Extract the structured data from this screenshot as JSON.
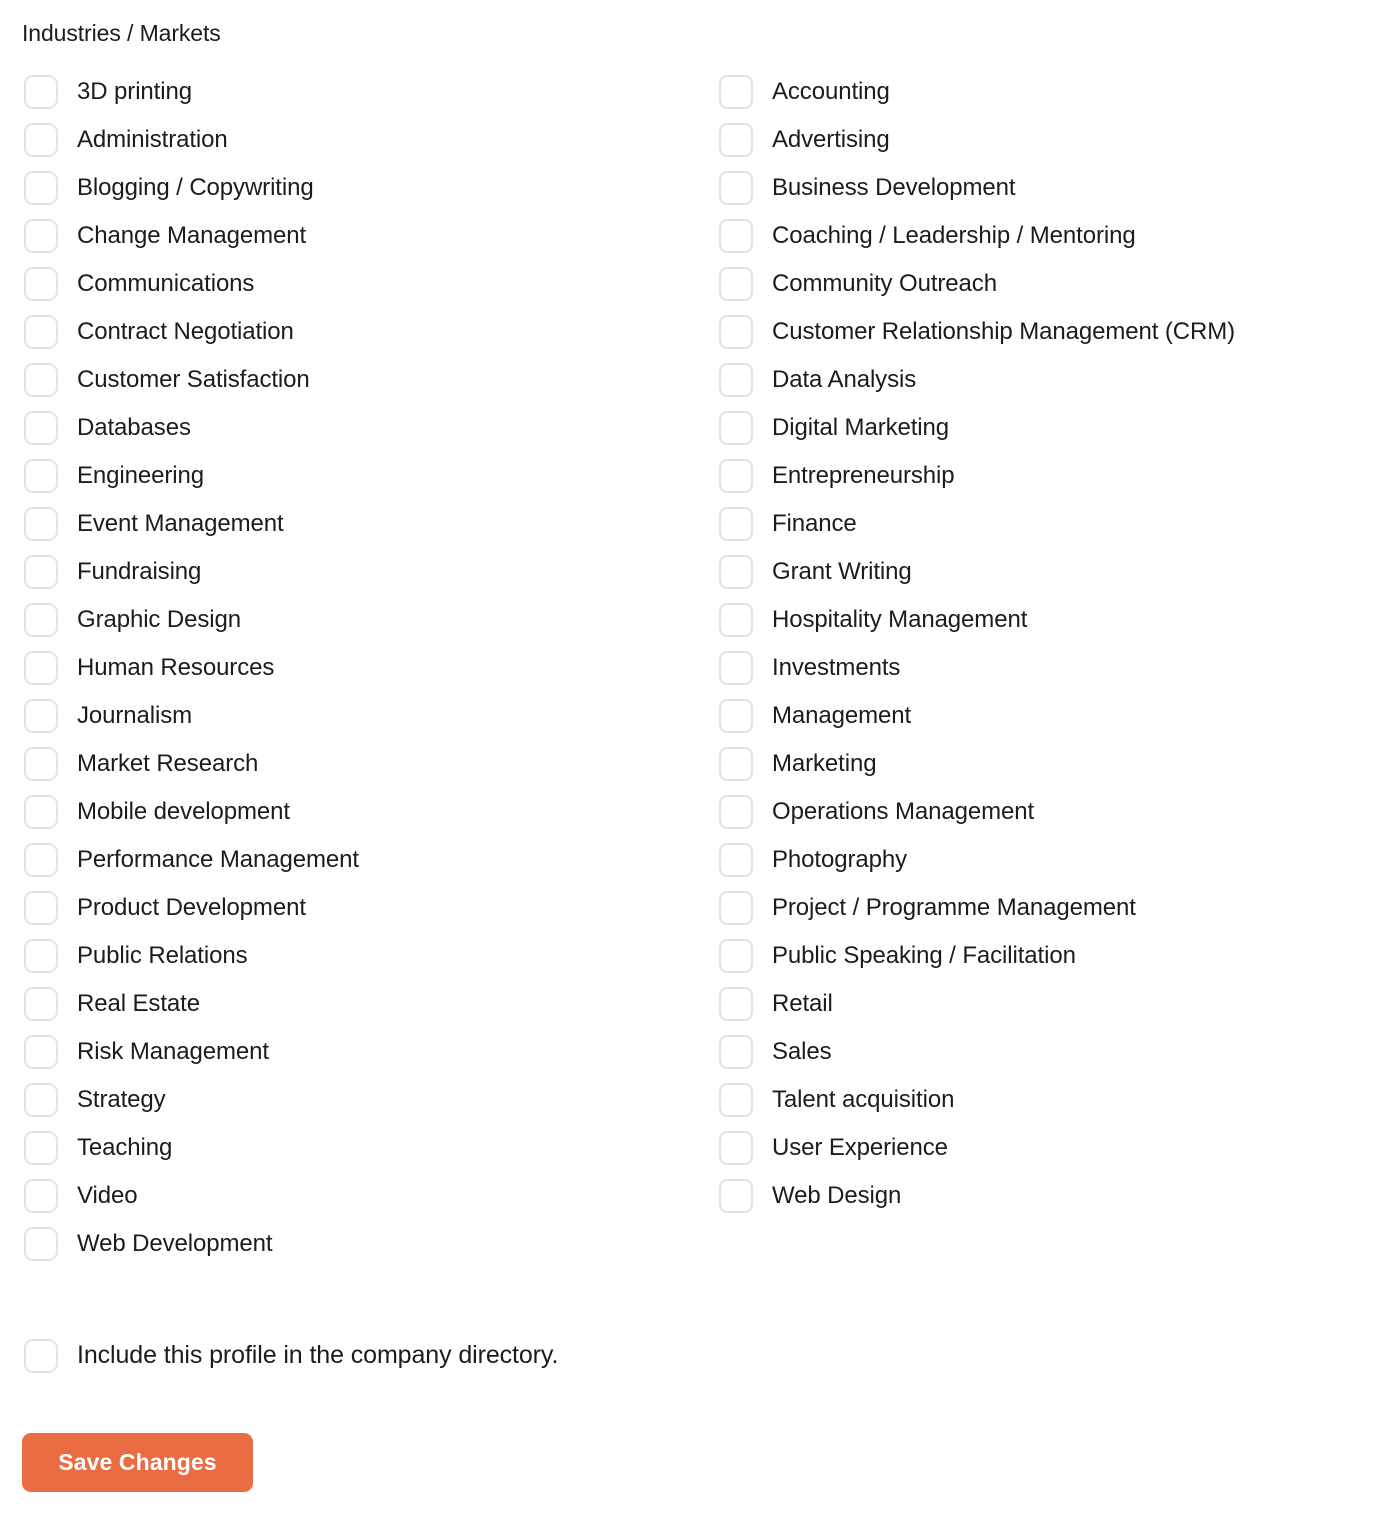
{
  "section": {
    "title": "Industries / Markets"
  },
  "colors": {
    "accent": "#ea6c43",
    "text": "#1c1c1c",
    "checkbox_border": "#e3e3e3",
    "background": "#ffffff"
  },
  "checkbox_state": "unchecked",
  "columns": {
    "left": [
      {
        "label": "3D printing",
        "checked": false
      },
      {
        "label": "Administration",
        "checked": false
      },
      {
        "label": "Blogging / Copywriting",
        "checked": false
      },
      {
        "label": "Change Management",
        "checked": false
      },
      {
        "label": "Communications",
        "checked": false
      },
      {
        "label": "Contract Negotiation",
        "checked": false
      },
      {
        "label": "Customer Satisfaction",
        "checked": false
      },
      {
        "label": "Databases",
        "checked": false
      },
      {
        "label": "Engineering",
        "checked": false
      },
      {
        "label": "Event Management",
        "checked": false
      },
      {
        "label": "Fundraising",
        "checked": false
      },
      {
        "label": "Graphic Design",
        "checked": false
      },
      {
        "label": "Human Resources",
        "checked": false
      },
      {
        "label": "Journalism",
        "checked": false
      },
      {
        "label": "Market Research",
        "checked": false
      },
      {
        "label": "Mobile development",
        "checked": false
      },
      {
        "label": "Performance Management",
        "checked": false
      },
      {
        "label": "Product Development",
        "checked": false
      },
      {
        "label": "Public Relations",
        "checked": false
      },
      {
        "label": "Real Estate",
        "checked": false
      },
      {
        "label": "Risk Management",
        "checked": false
      },
      {
        "label": "Strategy",
        "checked": false
      },
      {
        "label": "Teaching",
        "checked": false
      },
      {
        "label": "Video",
        "checked": false
      },
      {
        "label": "Web Development",
        "checked": false
      }
    ],
    "right": [
      {
        "label": "Accounting",
        "checked": false
      },
      {
        "label": "Advertising",
        "checked": false
      },
      {
        "label": "Business Development",
        "checked": false
      },
      {
        "label": "Coaching / Leadership / Mentoring",
        "checked": false
      },
      {
        "label": "Community Outreach",
        "checked": false
      },
      {
        "label": "Customer Relationship Management (CRM)",
        "checked": false
      },
      {
        "label": "Data Analysis",
        "checked": false
      },
      {
        "label": "Digital Marketing",
        "checked": false
      },
      {
        "label": "Entrepreneurship",
        "checked": false
      },
      {
        "label": "Finance",
        "checked": false
      },
      {
        "label": "Grant Writing",
        "checked": false
      },
      {
        "label": "Hospitality Management",
        "checked": false
      },
      {
        "label": "Investments",
        "checked": false
      },
      {
        "label": "Management",
        "checked": false
      },
      {
        "label": "Marketing",
        "checked": false
      },
      {
        "label": "Operations Management",
        "checked": false
      },
      {
        "label": "Photography",
        "checked": false
      },
      {
        "label": "Project / Programme Management",
        "checked": false
      },
      {
        "label": "Public Speaking / Facilitation",
        "checked": false
      },
      {
        "label": "Retail",
        "checked": false
      },
      {
        "label": "Sales",
        "checked": false
      },
      {
        "label": "Talent acquisition",
        "checked": false
      },
      {
        "label": "User Experience",
        "checked": false
      },
      {
        "label": "Web Design",
        "checked": false
      }
    ]
  },
  "directory": {
    "label": "Include this profile in the company directory.",
    "checked": false
  },
  "actions": {
    "save_label": "Save Changes"
  }
}
